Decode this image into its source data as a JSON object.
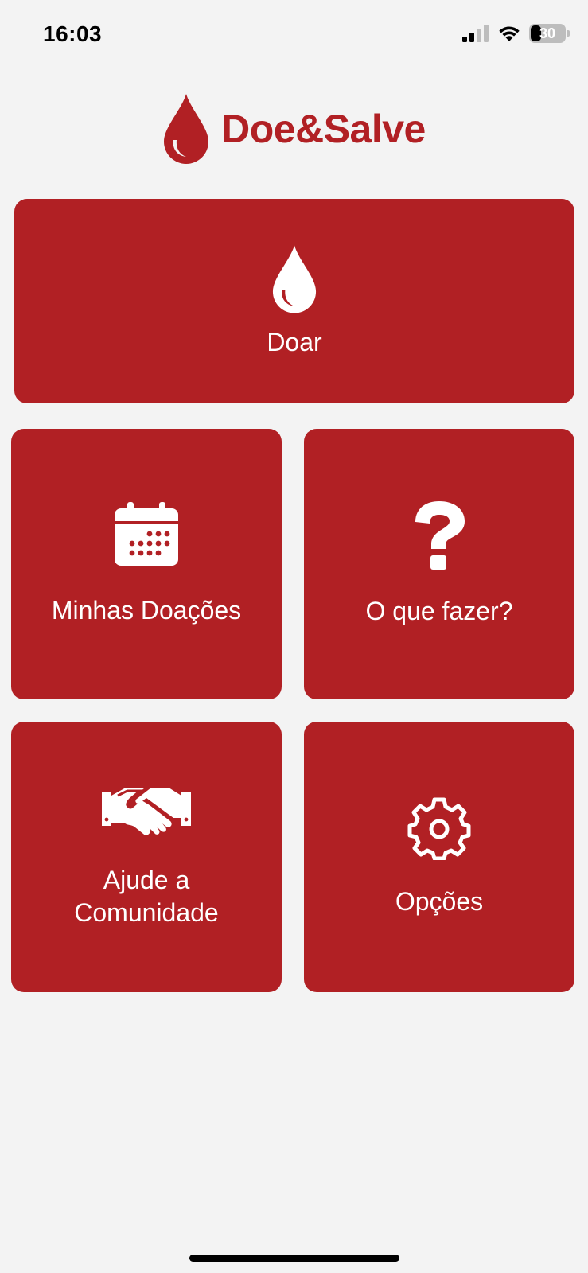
{
  "status_bar": {
    "time": "16:03",
    "battery_level": "30",
    "signal_icon": "cellular-signal-icon",
    "wifi_icon": "wifi-icon"
  },
  "header": {
    "title": "Doe&Salve",
    "logo_icon": "blood-drop-icon"
  },
  "tiles": {
    "doar": {
      "label": "Doar",
      "icon": "blood-drop-icon"
    },
    "minhas_doacoes": {
      "label": "Minhas Doações",
      "icon": "calendar-icon"
    },
    "o_que_fazer": {
      "label": "O que fazer?",
      "icon": "question-mark-icon"
    },
    "ajude": {
      "label": "Ajude a Comunidade",
      "icon": "handshake-icon"
    },
    "opcoes": {
      "label": "Opções",
      "icon": "gear-icon"
    }
  },
  "colors": {
    "brand": "#B12024",
    "background": "#F3F3F3",
    "tile_text": "#FFFFFF"
  }
}
